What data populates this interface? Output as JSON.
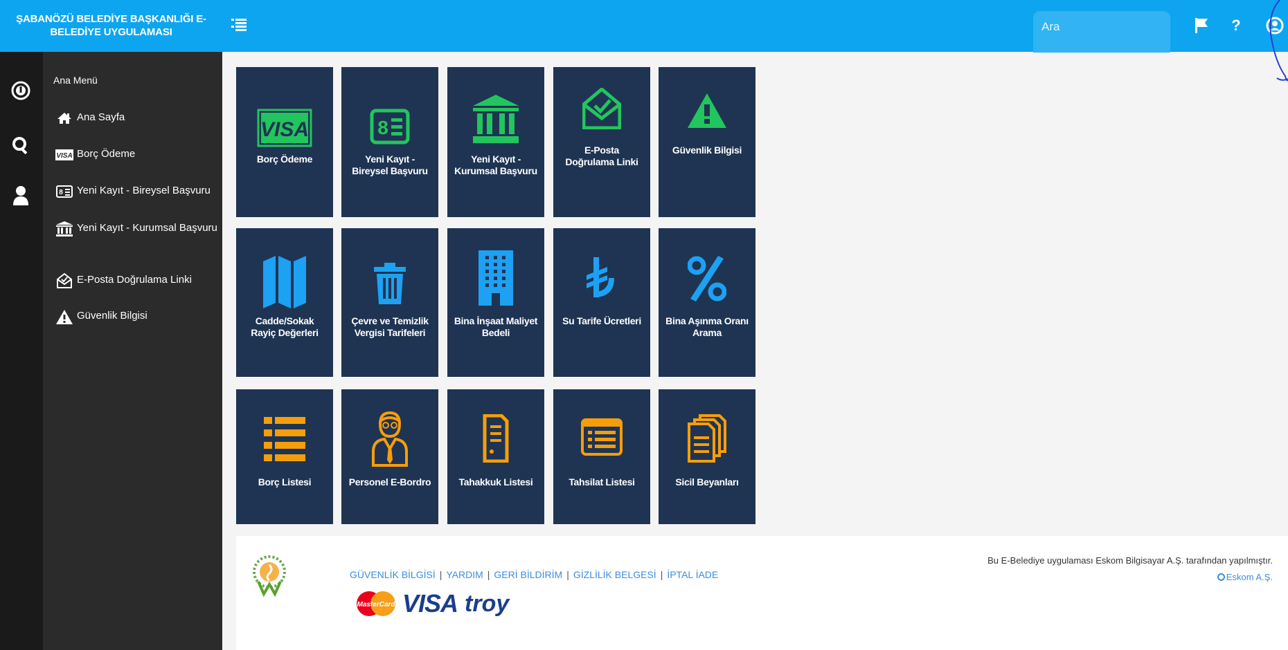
{
  "header": {
    "brand_line1": "ŞABANÖZÜ BELEDİYE BAŞKANLIĞI E-",
    "brand_line2": "BELEDİYE UYGULAMASI",
    "search_placeholder": "Ara",
    "help_label": "?",
    "menu_icon": "menu-toggle-icon",
    "flag_icon": "flag-icon",
    "user_icon": "user-circle-icon"
  },
  "rail": {
    "icons": [
      "dashboard-gauge-icon",
      "search-icon",
      "user-icon"
    ]
  },
  "sidebar": {
    "title": "Ana Menü",
    "items": [
      {
        "label": "Ana Sayfa",
        "icon": "home-icon"
      },
      {
        "label": "Borç Ödeme",
        "icon": "visa-card-icon"
      },
      {
        "label": "Yeni Kayıt - Bireysel Başvuru",
        "icon": "id-card-icon"
      },
      {
        "label": "Yeni Kayıt - Kurumsal Başvuru",
        "icon": "institution-icon"
      },
      {
        "label": "E-Posta Doğrulama Linki",
        "icon": "email-verify-icon"
      },
      {
        "label": "Güvenlik Bilgisi",
        "icon": "warning-icon"
      }
    ]
  },
  "tiles": [
    {
      "label": "Borç Ödeme",
      "icon": "visa-card-icon",
      "color": "#22c55e"
    },
    {
      "label": "Yeni Kayıt - Bireysel Başvuru",
      "icon": "id-card-icon",
      "color": "#22c55e"
    },
    {
      "label": "Yeni Kayıt - Kurumsal Başvuru",
      "icon": "institution-icon",
      "color": "#22c55e"
    },
    {
      "label": "E-Posta Doğrulama Linki",
      "icon": "email-verify-icon",
      "color": "#22c55e"
    },
    {
      "label": "Güvenlik Bilgisi",
      "icon": "warning-icon",
      "color": "#22c55e"
    },
    {
      "label": "Cadde/Sokak Rayiç Değerleri",
      "icon": "map-icon",
      "color": "#1da1f2"
    },
    {
      "label": "Çevre ve Temizlik Vergisi Tarifeleri",
      "icon": "trash-icon",
      "color": "#1da1f2"
    },
    {
      "label": "Bina İnşaat Maliyet Bedeli",
      "icon": "building-icon",
      "color": "#1da1f2"
    },
    {
      "label": "Su Tarife Ücretleri",
      "icon": "lira-icon",
      "color": "#1da1f2"
    },
    {
      "label": "Bina Aşınma Oranı Arama",
      "icon": "percent-icon",
      "color": "#1da1f2"
    },
    {
      "label": "Borç Listesi",
      "icon": "list-icon",
      "color": "#f59e0b"
    },
    {
      "label": "Personel E-Bordro",
      "icon": "employee-icon",
      "color": "#f59e0b"
    },
    {
      "label": "Tahakkuk Listesi",
      "icon": "document-icon",
      "color": "#f59e0b"
    },
    {
      "label": "Tahsilat Listesi",
      "icon": "list-window-icon",
      "color": "#f59e0b"
    },
    {
      "label": "Sicil Beyanları",
      "icon": "files-icon",
      "color": "#f59e0b"
    }
  ],
  "footer": {
    "links": [
      "GÜVENLİK BİLGİSİ",
      "YARDIM",
      "GERİ BİLDİRİM",
      "GİZLİLİK BELGESİ",
      "İPTAL İADE"
    ],
    "separator": "|",
    "credit": "Bu E-Belediye uygulaması Eskom Bilgisayar A.Ş. tarafından yapılmıştır.",
    "eskom_link": "Eskom A.Ş.",
    "card_logos": [
      "mastercard-logo",
      "visa-logo",
      "troy-logo"
    ],
    "mastercard_text": "MasterCard",
    "visa_text": "VISA",
    "troy_text": "troy"
  }
}
